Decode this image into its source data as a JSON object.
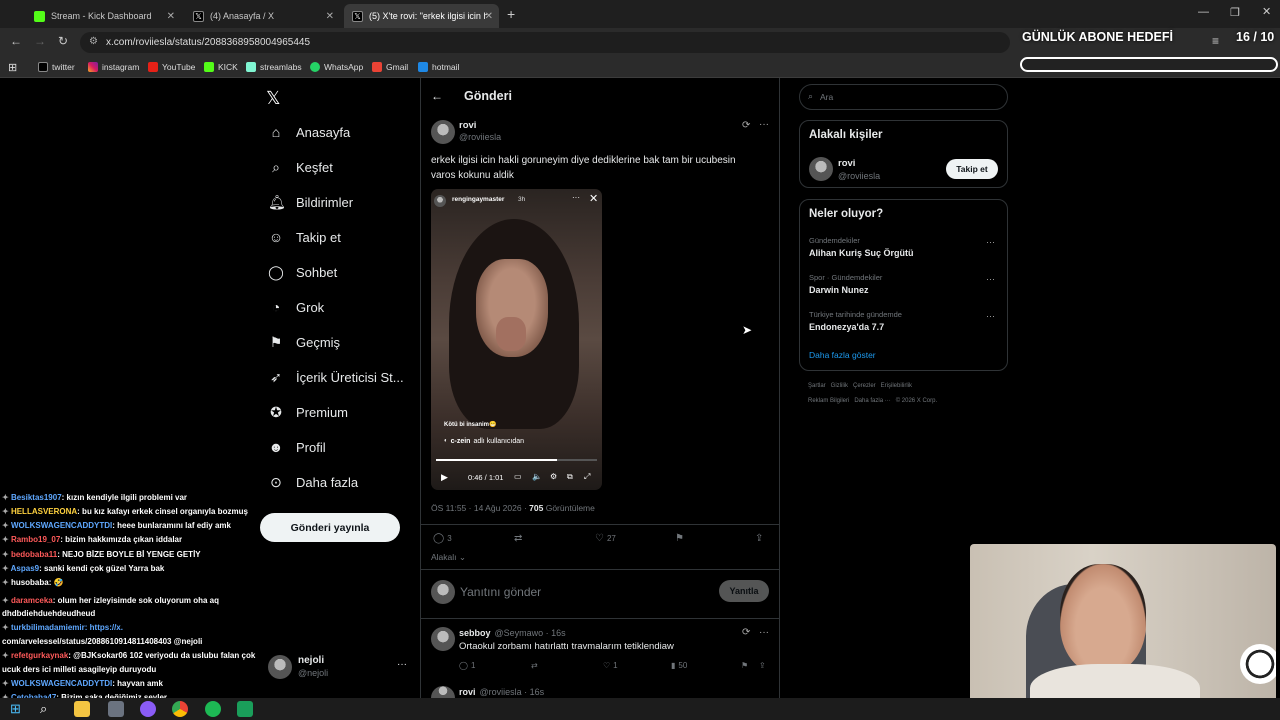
{
  "browser": {
    "tabs": [
      {
        "title": "Stream - Kick Dashboard",
        "color": "#53fc18",
        "active": false
      },
      {
        "title": "(4) Anasayfa / X",
        "color": "#000000",
        "active": false
      },
      {
        "title": "(5) X'te rovi: \"erkek ilgisi icin ha",
        "color": "#000000",
        "active": true
      }
    ],
    "url": "x.com/roviiesla/status/2088368958004965445",
    "bookmarks": [
      "twitter",
      "instagram",
      "YouTube",
      "KICK",
      "streamlabs",
      "WhatsApp",
      "Gmail",
      "hotmail"
    ]
  },
  "overlay": {
    "goal_label": "GÜNLÜK ABONE HEDEFİ",
    "goal_count": "16 / 10"
  },
  "nav": {
    "items": [
      {
        "label": "Anasayfa",
        "icon": "home-icon"
      },
      {
        "label": "Keşfet",
        "icon": "search-icon"
      },
      {
        "label": "Bildirimler",
        "icon": "bell-icon"
      },
      {
        "label": "Takip et",
        "icon": "follow-icon"
      },
      {
        "label": "Sohbet",
        "icon": "chat-icon"
      },
      {
        "label": "Grok",
        "icon": "grok-icon"
      },
      {
        "label": "Geçmiş",
        "icon": "bookmark-icon"
      },
      {
        "label": "İçerik Üreticisi St...",
        "icon": "rocket-icon"
      },
      {
        "label": "Premium",
        "icon": "verified-icon"
      },
      {
        "label": "Profil",
        "icon": "person-icon"
      },
      {
        "label": "Daha fazla",
        "icon": "more-icon"
      }
    ],
    "post_button": "Gönderi yayınla",
    "account": {
      "name": "nejoli",
      "handle": "@nejoli"
    }
  },
  "post": {
    "header": "Gönderi",
    "author": "rovi",
    "handle": "@roviiesla",
    "text_line1": "erkek ilgisi icin hakli goruneyim diye dediklerine bak tam bir ucubesin",
    "text_line2": "varos kokunu aldik",
    "video": {
      "story_user": "rengingaymaster",
      "story_time": "3h",
      "caption": "Kötü bi insanim😁",
      "sticker_user": "c-zein",
      "sticker_text": "adlı kullanıcıdan",
      "time": "0:46 / 1:01",
      "progress": 0.75
    },
    "meta_time": "ÖS 11:55 · 14 Ağu 2026 ·",
    "views": "705",
    "views_label": "Görüntüleme",
    "replies": "3",
    "likes": "27",
    "relevance": "Alakalı",
    "reply_placeholder": "Yanıtını gönder",
    "reply_button": "Yanıtla"
  },
  "replies": [
    {
      "name": "sebboy",
      "meta": "@Seymawo · 16s",
      "text": "Ortaokul zorbamı hatırlattı travmalarım tetiklendiaw",
      "replies": "1",
      "likes": "1",
      "views": "50"
    },
    {
      "name": "rovi",
      "meta": "@roviiesla · 16s"
    }
  ],
  "right": {
    "search_placeholder": "Ara",
    "related_title": "Alakalı kişiler",
    "related_name": "rovi",
    "related_handle": "@roviiesla",
    "follow_button": "Takip et",
    "trends_title": "Neler oluyor?",
    "trends": [
      {
        "category": "Gündemdekiler",
        "name": "Alihan Kuriş Suç Örgütü"
      },
      {
        "category": "Spor · Gündemdekiler",
        "name": "Darwin Nunez"
      },
      {
        "category": "Türkiye tarihinde gündemde",
        "name": "Endonezya'da 7.7"
      }
    ],
    "show_more": "Daha fazla göster",
    "footer1": "Şartlar   Gizlilik   Çerezler   Erişilebilirlik",
    "footer2": "Reklam Bilgileri   Daha fazla ···   © 2026 X Corp."
  },
  "chat": [
    {
      "user": "Besiktas1907",
      "msg": ": kızın kendiyle ilgili problemi var",
      "color": "#5fa8ff"
    },
    {
      "user": "HELLASVERONA",
      "msg": ": bu kız kafayı erkek cinsel organıyla bozmuş",
      "color": "#ffd23f"
    },
    {
      "user": "WOLKSWAGENCADDYTDI",
      "msg": ": heee bunlaramını laf ediy amk",
      "color": "#5fa8ff"
    },
    {
      "user": "Rambo19_07",
      "msg": ": bizim hakkımızda çıkan iddalar",
      "color": "#ff5a5a"
    },
    {
      "user": "bedobaba11",
      "msg": ": NEJO BİZE BOYLE Bİ YENGE GETİY",
      "color": "#ff5a5a"
    },
    {
      "user": "Aspas9",
      "msg": ": sanki kendi çok güzel Yarra bak",
      "color": "#5fa8ff"
    },
    {
      "user": "husobaba",
      "msg": ": 🤣",
      "color": "#ffffff"
    },
    {
      "user": "daramceka",
      "msg": ": olum her izleyisimde sok oluyorum oha aq",
      "color": "#ff5a5a"
    },
    {
      "user": "",
      "msg": "dhdbdiehduehdeudheud",
      "color": "#ffffff"
    },
    {
      "user": "turkbilimadamiemir",
      "msg": ": https://x.",
      "color": "#5fa8ff"
    },
    {
      "user": "",
      "msg": "com/arvelessel/status/2088610914811408403 @nejoli",
      "color": "#ffffff"
    },
    {
      "user": "refetgurkaynak",
      "msg": ": @BJKsokar06 102 veriyodu da uslubu falan çok",
      "color": "#ff5a5a"
    },
    {
      "user": "",
      "msg": "ucuk ders ici milleti asagileyip duruyodu",
      "color": "#ffffff"
    },
    {
      "user": "WOLKSWAGENCADDYTDI",
      "msg": ": hayvan amk",
      "color": "#5fa8ff"
    },
    {
      "user": "Cetobaba47",
      "msg": ": Bizim şaka değiğimiz şeyler",
      "color": "#5fa8ff"
    }
  ]
}
